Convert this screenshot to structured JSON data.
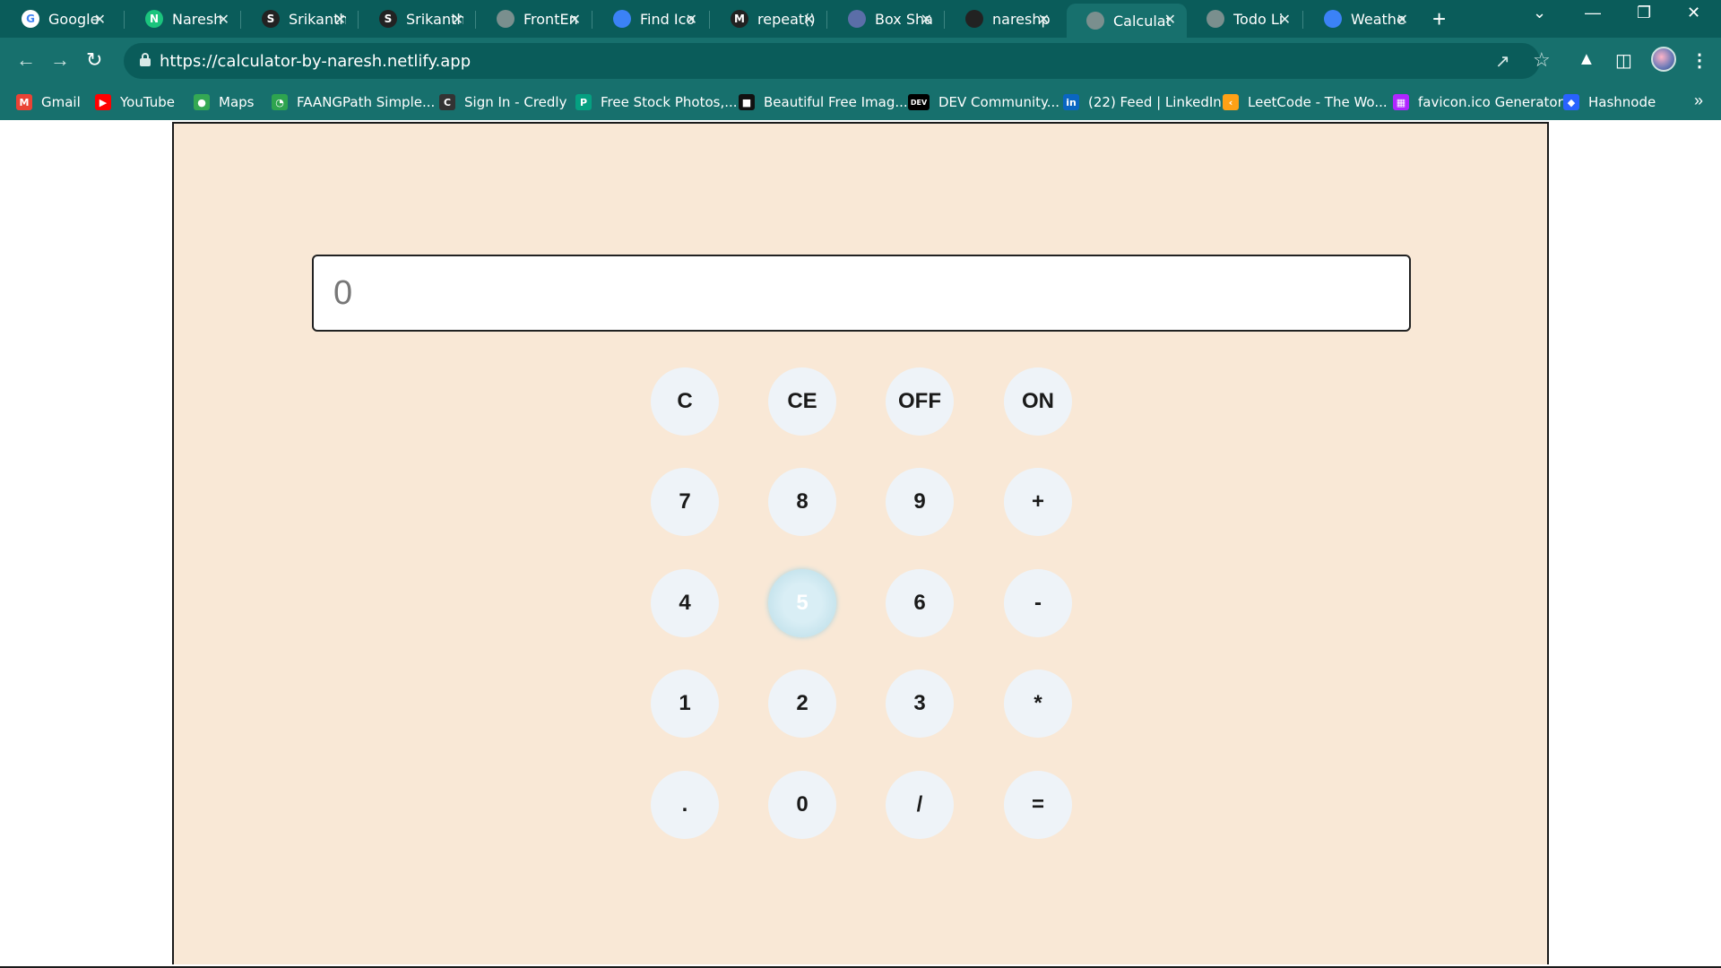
{
  "browser": {
    "tabs": [
      {
        "title": "Google",
        "icon": "google-icon",
        "color": "#ffffff"
      },
      {
        "title": "Naresh",
        "icon": "notion-icon",
        "color": "#1bc47d"
      },
      {
        "title": "Srikanth",
        "icon": "s-brand-icon",
        "color": "#222222"
      },
      {
        "title": "Srikanth",
        "icon": "s-brand-icon",
        "color": "#222222"
      },
      {
        "title": "FrontEn",
        "icon": "globe-icon",
        "color": "#7a8f8e"
      },
      {
        "title": "Find Ico",
        "icon": "flag-icon",
        "color": "#3b82f6"
      },
      {
        "title": "repeat()",
        "icon": "mdn-icon",
        "color": "#222222"
      },
      {
        "title": "Box Sha",
        "icon": "box-icon",
        "color": "#5b6ea8"
      },
      {
        "title": "nareshp",
        "icon": "github-icon",
        "color": "#222222"
      },
      {
        "title": "Calculat",
        "icon": "globe-icon",
        "color": "#7a8f8e"
      },
      {
        "title": "Todo Li",
        "icon": "globe-icon",
        "color": "#7a8f8e"
      },
      {
        "title": "Weathe",
        "icon": "cloud-icon",
        "color": "#3b82f6"
      }
    ],
    "active_tab_index": 9,
    "new_tab_label": "+",
    "url": "https://calculator-by-naresh.netlify.app",
    "bookmarks": [
      {
        "label": "Gmail",
        "icon": "gmail-icon",
        "color": "#ea4335"
      },
      {
        "label": "YouTube",
        "icon": "youtube-icon",
        "color": "#ff0000"
      },
      {
        "label": "Maps",
        "icon": "maps-icon",
        "color": "#34a853"
      },
      {
        "label": "FAANGPath Simple...",
        "icon": "faangpath-icon",
        "color": "#2ea44f"
      },
      {
        "label": "Sign In - Credly",
        "icon": "credly-icon",
        "color": "#333333"
      },
      {
        "label": "Free Stock Photos,...",
        "icon": "pexels-icon",
        "color": "#05a081"
      },
      {
        "label": "Beautiful Free Imag...",
        "icon": "unsplash-icon",
        "color": "#111111"
      },
      {
        "label": "DEV Community...",
        "icon": "dev-icon",
        "color": "#000000"
      },
      {
        "label": "(22) Feed | LinkedIn",
        "icon": "linkedin-icon",
        "color": "#0a66c2"
      },
      {
        "label": "LeetCode - The Wo...",
        "icon": "leetcode-icon",
        "color": "#ffa116"
      },
      {
        "label": "favicon.ico Generator",
        "icon": "favicon-generator-icon",
        "color": "#b026ff"
      },
      {
        "label": "Hashnode",
        "icon": "hashnode-icon",
        "color": "#2962ff"
      }
    ]
  },
  "calculator": {
    "display_value": "0",
    "keys": [
      [
        "C",
        "CE",
        "OFF",
        "ON"
      ],
      [
        "7",
        "8",
        "9",
        "+"
      ],
      [
        "4",
        "5",
        "6",
        "-"
      ],
      [
        "1",
        "2",
        "3",
        "*"
      ],
      [
        ".",
        "0",
        "/",
        "="
      ]
    ],
    "highlighted_key": "5"
  },
  "colors": {
    "chrome": "#17706d",
    "tabstrip": "#0a5c5a",
    "panel_bg": "#f9e8d6",
    "key_bg": "#eef3f8"
  }
}
